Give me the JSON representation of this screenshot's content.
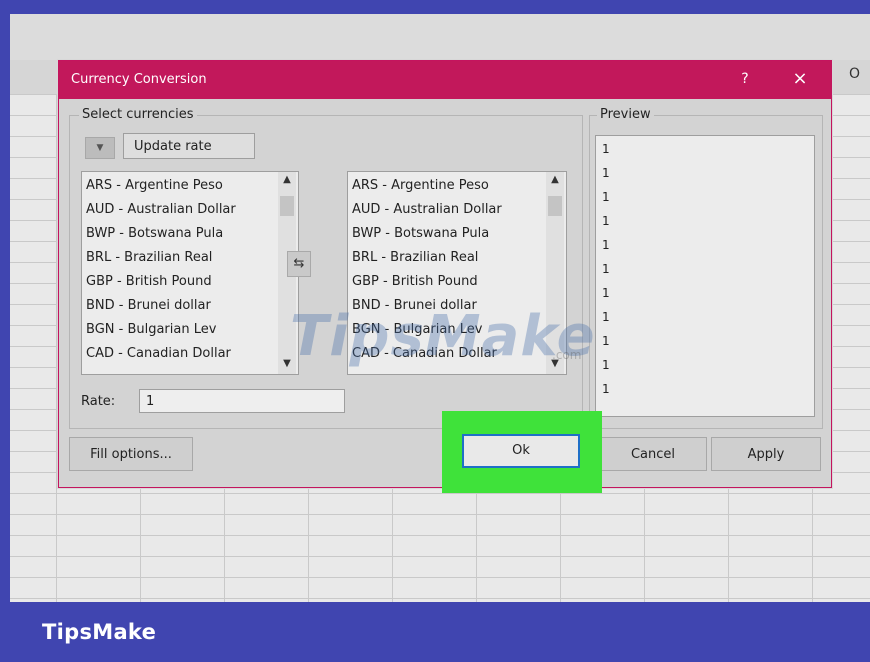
{
  "dialog": {
    "title": "Currency Conversion",
    "help_label": "?",
    "close_label": "×",
    "select_currencies_label": "Select currencies",
    "dropdown_arrow": "▼",
    "update_rate_label": "Update rate",
    "swap_label": "⇆",
    "rate_label": "Rate:",
    "rate_value": "1",
    "preview_label": "Preview",
    "fill_options_label": "Fill options...",
    "ok_label": "Ok",
    "cancel_label": "Cancel",
    "apply_label": "Apply"
  },
  "source_currencies": [
    "ARS - Argentine Peso",
    "AUD - Australian Dollar",
    "BWP - Botswana Pula",
    "BRL - Brazilian Real",
    "GBP - British Pound",
    "BND - Brunei dollar",
    "BGN - Bulgarian Lev",
    "CAD - Canadian Dollar"
  ],
  "target_currencies": [
    "ARS - Argentine Peso",
    "AUD - Australian Dollar",
    "BWP - Botswana Pula",
    "BRL - Brazilian Real",
    "GBP - British Pound",
    "BND - Brunei dollar",
    "BGN - Bulgarian Lev",
    "CAD - Canadian Dollar"
  ],
  "preview_values": [
    "1",
    "1",
    "1",
    "1",
    "1",
    "1",
    "1",
    "1",
    "1",
    "1",
    "1"
  ],
  "sheet": {
    "column_letter": "O"
  },
  "brand": "TipsMake",
  "watermark": {
    "main": "TipsMake",
    "suffix": ".com"
  },
  "colors": {
    "title_bar": "#c2185b",
    "highlight": "#3fe23a",
    "frame": "#4045b0"
  }
}
